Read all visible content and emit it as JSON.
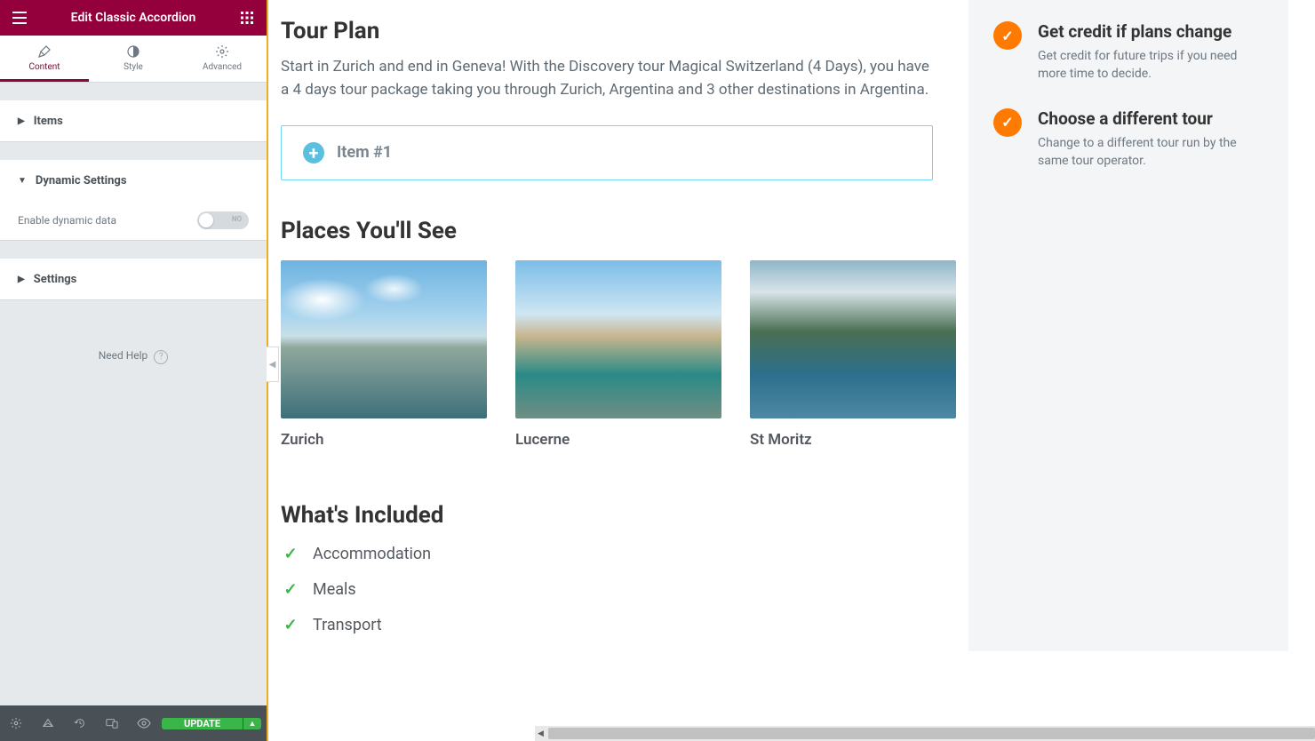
{
  "header": {
    "title": "Edit Classic Accordion"
  },
  "tabs": {
    "content": "Content",
    "style": "Style",
    "advanced": "Advanced"
  },
  "panels": {
    "items": "Items",
    "dynamic": "Dynamic Settings",
    "enable_dynamic": "Enable dynamic data",
    "toggle_no": "NO",
    "settings": "Settings"
  },
  "need_help": "Need Help",
  "footer": {
    "update": "UPDATE"
  },
  "main": {
    "tour_plan": {
      "heading": "Tour Plan",
      "desc": "Start in Zurich and end in Geneva! With the Discovery tour Magical Switzerland (4 Days), you have a 4 days tour package taking you through Zurich, Argentina and 3 other destinations in Argentina."
    },
    "accordion_item": "Item #1",
    "places_heading": "Places You'll See",
    "places": [
      {
        "name": "Zurich"
      },
      {
        "name": "Lucerne"
      },
      {
        "name": "St Moritz"
      }
    ],
    "included_heading": "What's Included",
    "included": [
      "Accommodation",
      "Meals",
      "Transport"
    ]
  },
  "sidebar_right": {
    "items": [
      {
        "title": "Get credit if plans change",
        "desc": "Get credit for future trips if you need more time to decide."
      },
      {
        "title": "Choose a different tour",
        "desc": "Change to a different tour run by the same tour operator."
      }
    ]
  }
}
